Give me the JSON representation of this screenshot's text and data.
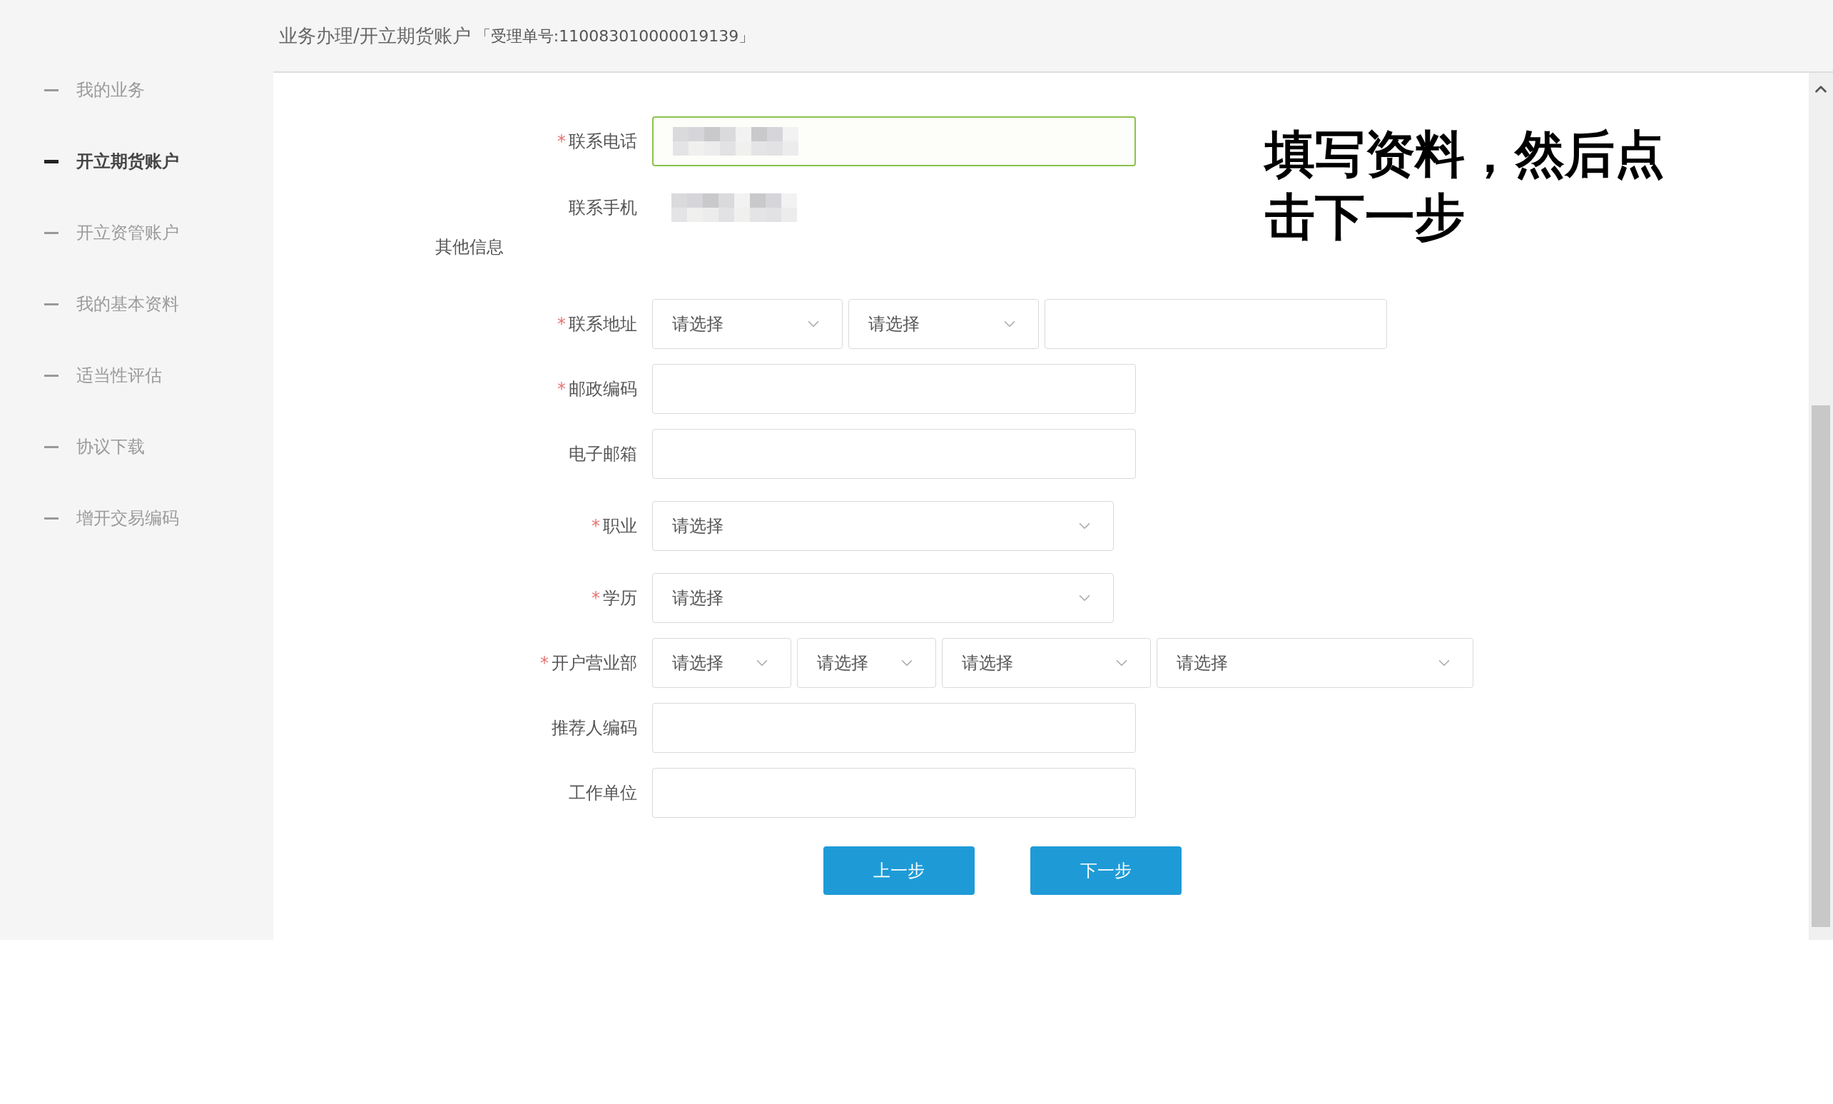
{
  "breadcrumb": {
    "path": "业务办理/开立期货账户",
    "ticket": "「受理单号:110083010000019139」"
  },
  "sidebar": {
    "items": [
      {
        "label": "我的业务",
        "selected": false
      },
      {
        "label": "开立期货账户",
        "selected": true
      },
      {
        "label": "开立资管账户",
        "selected": false
      },
      {
        "label": "我的基本资料",
        "selected": false
      },
      {
        "label": "适当性评估",
        "selected": false
      },
      {
        "label": "协议下载",
        "selected": false
      },
      {
        "label": "增开交易编码",
        "selected": false
      }
    ]
  },
  "form": {
    "rows": [
      {
        "kind": "text",
        "required_mark": "*",
        "label": "联系电话",
        "focused": true,
        "blurred_value": true
      },
      {
        "kind": "static",
        "label": "联系手机",
        "blurred_value": true
      },
      {
        "kind": "section",
        "label": "其他信息"
      },
      {
        "kind": "multi",
        "required_mark": "*",
        "label": "联系地址",
        "controls": [
          {
            "kind": "select",
            "placeholder": "请选择"
          },
          {
            "kind": "select",
            "placeholder": "请选择"
          },
          {
            "kind": "text"
          }
        ]
      },
      {
        "kind": "text",
        "required_mark": "*",
        "label": "邮政编码",
        "focused": false
      },
      {
        "kind": "text",
        "label": "电子邮箱",
        "focused": false
      },
      {
        "kind": "select",
        "required_mark": "*",
        "label": "职业",
        "placeholder": "请选择"
      },
      {
        "kind": "select",
        "required_mark": "*",
        "label": "学历",
        "placeholder": "请选择"
      },
      {
        "kind": "multi",
        "required_mark": "*",
        "label": "开户营业部",
        "controls": [
          {
            "kind": "select",
            "placeholder": "请选择"
          },
          {
            "kind": "select",
            "placeholder": "请选择"
          },
          {
            "kind": "select",
            "placeholder": "请选择"
          },
          {
            "kind": "select",
            "placeholder": "请选择"
          }
        ]
      },
      {
        "kind": "text",
        "label": "推荐人编码",
        "focused": false
      },
      {
        "kind": "text",
        "label": "工作单位",
        "focused": false
      }
    ],
    "buttons": [
      "上一步",
      "下一步"
    ]
  },
  "annotation": "填写资料，然后点击下一步"
}
